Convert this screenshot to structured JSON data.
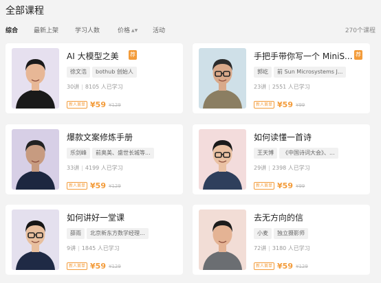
{
  "page": {
    "title": "全部课程"
  },
  "sort": {
    "items": [
      "综合",
      "最新上架",
      "学习人数",
      "价格",
      "活动"
    ],
    "price_arrows": "▲▼",
    "count": "270个课程"
  },
  "courses": [
    {
      "title": "AI 大模型之美",
      "hot": "荐",
      "tags": [
        "徐文浩",
        "bothub 创始人"
      ],
      "lessons": "30讲",
      "learners": "8105 人已学习",
      "badge": "新人首单",
      "price": "¥59",
      "old_price": "¥129",
      "bg": "#e6e0ef",
      "skin": "#e7b796",
      "hair": "#1a1a1a",
      "cloth": "#1a1a1a",
      "glasses": false
    },
    {
      "title": "手把手带你写一个 MiniS...",
      "hot": "荐",
      "tags": [
        "郭屹",
        "前 Sun Microsystems J..."
      ],
      "lessons": "23讲",
      "learners": "2551 人已学习",
      "badge": "新人首单",
      "price": "¥59",
      "old_price": "¥99",
      "bg": "#cfe0e8",
      "skin": "#d9a98a",
      "hair": "#2b2b2b",
      "cloth": "#8b7e62",
      "glasses": true
    },
    {
      "title": "爆款文案修炼手册",
      "hot": "",
      "tags": [
        "乐剑峰",
        "前奥美、盛世长城等..."
      ],
      "lessons": "33讲",
      "learners": "4199 人已学习",
      "badge": "新人首单",
      "price": "¥59",
      "old_price": "¥129",
      "bg": "#d7cfe6",
      "skin": "#c79b80",
      "hair": "#222222",
      "cloth": "#1d2740",
      "glasses": false
    },
    {
      "title": "如何读懂一首诗",
      "hot": "",
      "tags": [
        "王天博",
        "《中国诗词大会》、..."
      ],
      "lessons": "29讲",
      "learners": "2398 人已学习",
      "badge": "新人首单",
      "price": "¥59",
      "old_price": "¥99",
      "bg": "#f3dcdc",
      "skin": "#eac1a3",
      "hair": "#1a1a1a",
      "cloth": "#2f3f5c",
      "glasses": true
    },
    {
      "title": "如何讲好一堂课",
      "hot": "",
      "tags": [
        "薛雨",
        "北京新东方数学经理..."
      ],
      "lessons": "9讲",
      "learners": "1845 人已学习",
      "badge": "新人首单",
      "price": "¥59",
      "old_price": "¥129",
      "bg": "#e4e0ee",
      "skin": "#e8bf9e",
      "hair": "#161616",
      "cloth": "#1f2a45",
      "glasses": true
    },
    {
      "title": "去无方向的信",
      "hot": "",
      "tags": [
        "小麦",
        "独立摄影师"
      ],
      "lessons": "72讲",
      "learners": "3180 人已学习",
      "badge": "新人首单",
      "price": "¥59",
      "old_price": "¥129",
      "bg": "#f2ddd6",
      "skin": "#e4b394",
      "hair": "#1c1c1c",
      "cloth": "#6b6e72",
      "glasses": false
    }
  ]
}
